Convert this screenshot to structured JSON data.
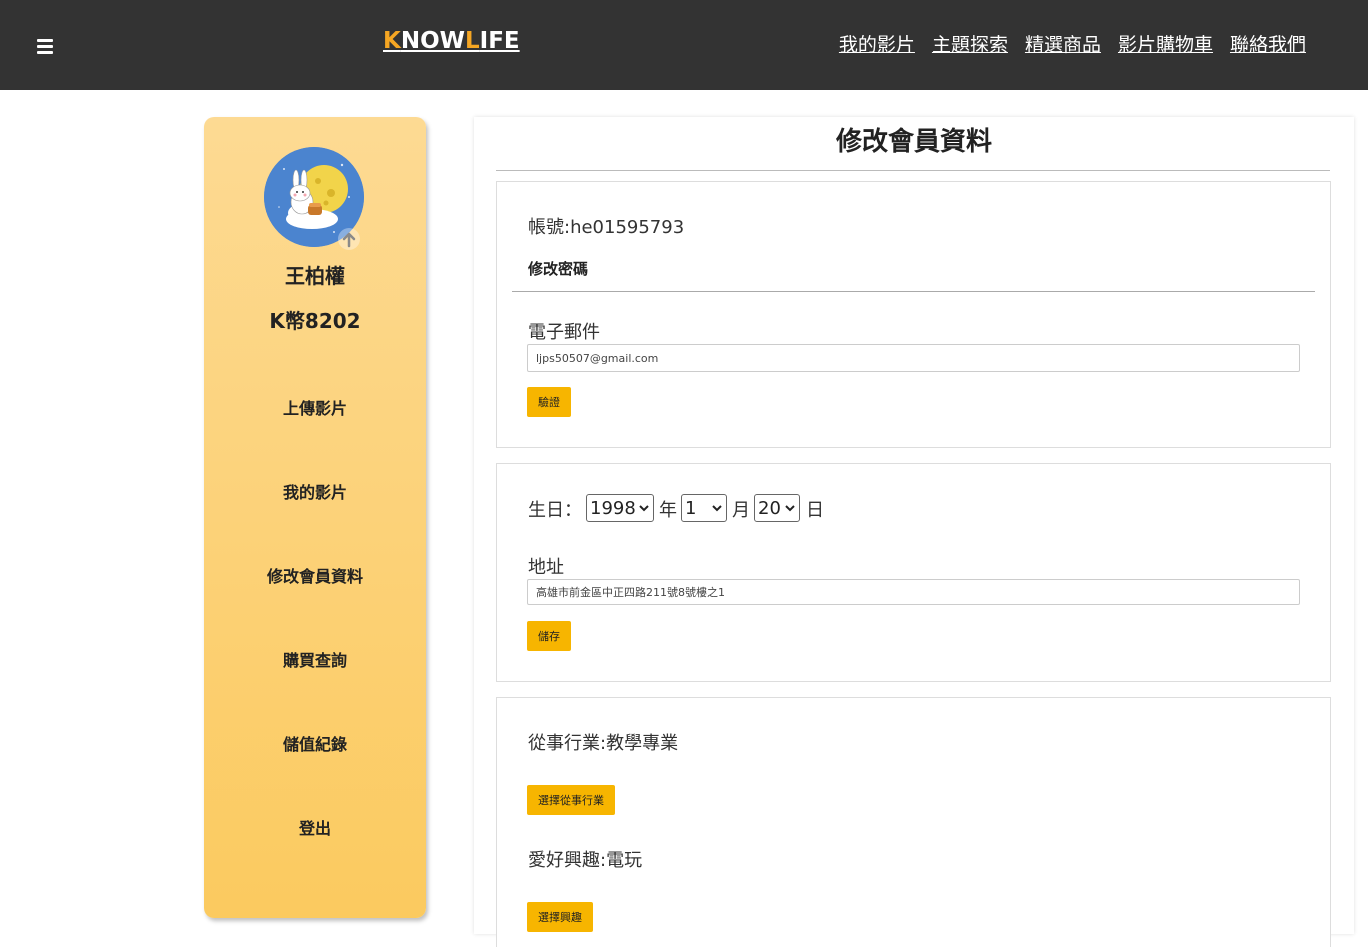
{
  "header": {
    "logo_k": "K",
    "logo_now": "NOW",
    "logo_l": "L",
    "logo_ife": "IFE",
    "nav": [
      "我的影片",
      "主題探索",
      "精選商品",
      "影片購物車",
      "聯絡我們"
    ]
  },
  "sidebar": {
    "user_name": "王柏權",
    "coins": "K幣8202",
    "menu": [
      "上傳影片",
      "我的影片",
      "修改會員資料",
      "購買查詢",
      "儲值紀錄",
      "登出"
    ]
  },
  "main": {
    "title": "修改會員資料",
    "account": {
      "account_label": "帳號:he01595793",
      "change_password": "修改密碼",
      "email_label": "電子郵件",
      "email_value": "ljps50507@gmail.com",
      "verify_button": "驗證"
    },
    "profile": {
      "birthday_label": "生日：",
      "year_value": "1998",
      "year_unit": "年",
      "month_value": "1",
      "month_unit": "月",
      "day_value": "20",
      "day_unit": "日",
      "address_label": "地址",
      "address_value": "高雄市前金區中正四路211號8號樓之1",
      "save_button": "儲存"
    },
    "interests": {
      "industry_label": "從事行業:教學專業",
      "industry_button": "選擇從事行業",
      "hobby_label": "愛好興趣:電玩",
      "hobby_button": "選擇興趣"
    }
  },
  "colors": {
    "header_bg": "#333333",
    "logo_accent": "#f5a623",
    "sidebar_top": "#fdda93",
    "sidebar_bottom": "#fbca5f",
    "button": "#f7b500",
    "avatar_bg": "#4b84cf"
  },
  "icons": [
    "hamburger-menu-icon",
    "avatar-rabbit-moon-image",
    "upload-arrow-icon",
    "select-caret-icon"
  ]
}
